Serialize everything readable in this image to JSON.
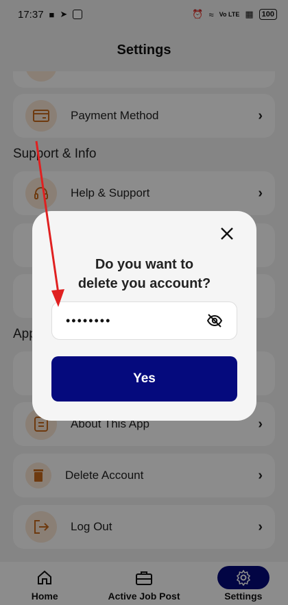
{
  "status_bar": {
    "time": "17:37",
    "battery": "100",
    "network": "Vo LTE"
  },
  "header": {
    "title": "Settings"
  },
  "cards": {
    "payment_method": "Payment Method",
    "help_support": "Help & Support",
    "about_app": "About This App",
    "delete_account": "Delete Account",
    "log_out": "Log Out"
  },
  "sections": {
    "support_info": "Support & Info",
    "app_partial": "App"
  },
  "dialog": {
    "title_line1": "Do you want to",
    "title_line2": "delete you account?",
    "password_value": "••••••••",
    "confirm_label": "Yes"
  },
  "bottom_nav": {
    "home": "Home",
    "active_job_post": "Active Job Post",
    "settings": "Settings"
  },
  "colors": {
    "primary": "#050a7d",
    "icon_accent": "#c96a1d",
    "annotation": "#e02020"
  }
}
